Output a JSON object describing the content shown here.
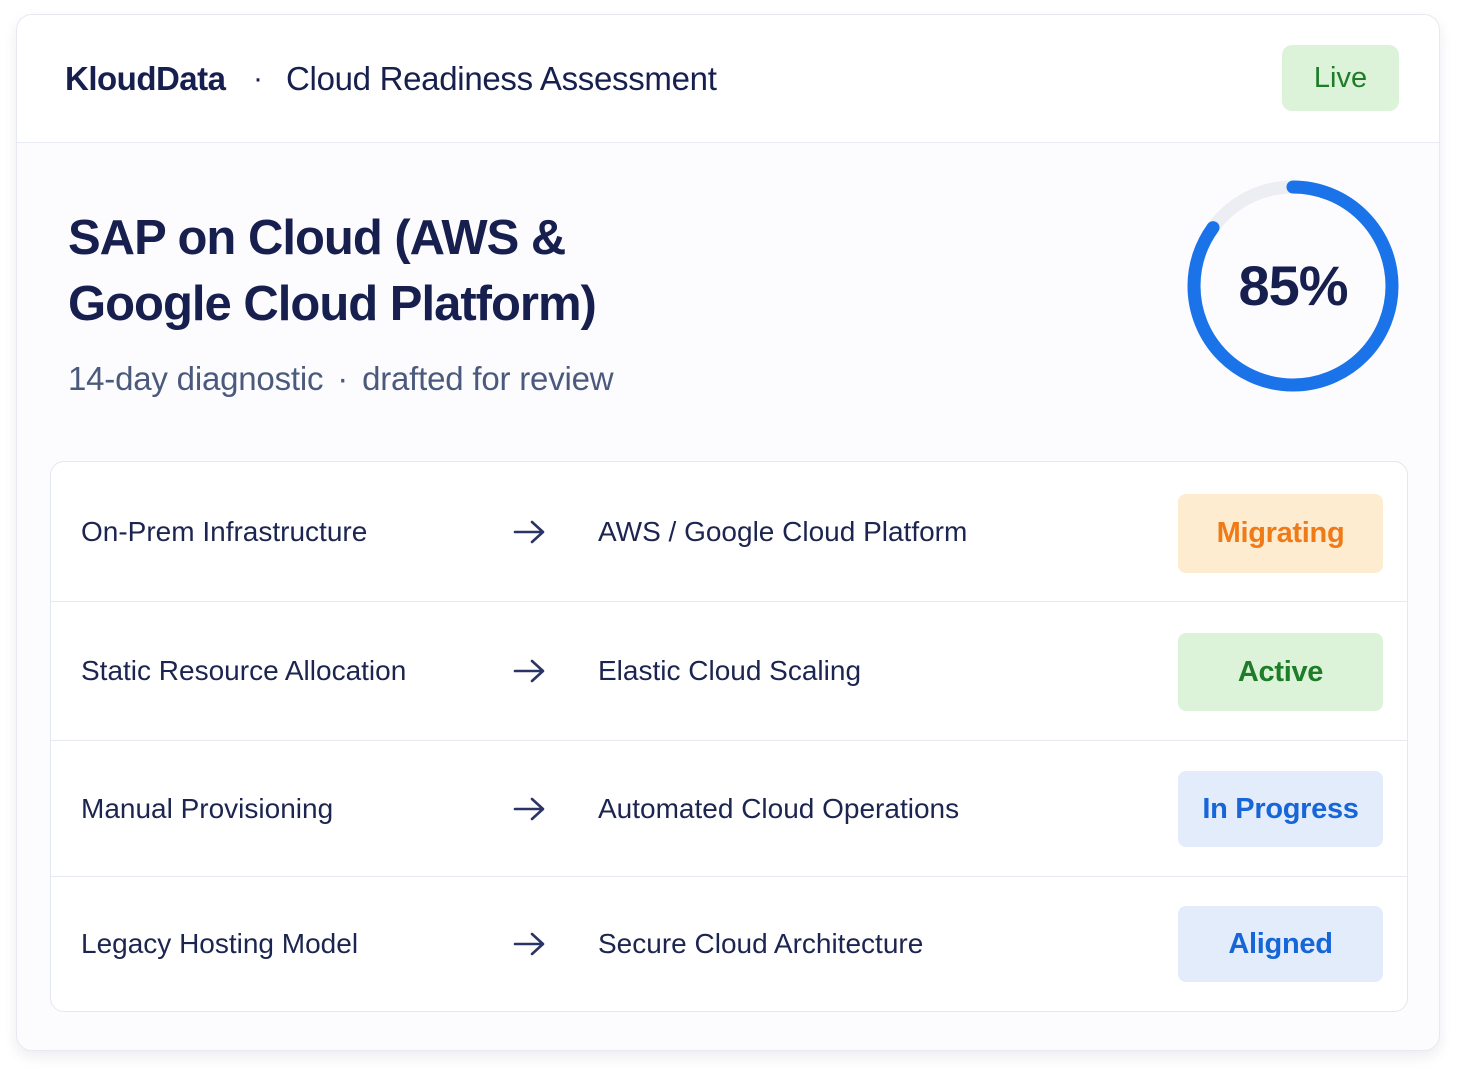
{
  "header": {
    "brand": "KloudData",
    "separator": "·",
    "title": "Cloud Readiness Assessment",
    "status_badge": "Live",
    "status_color": "#1f7d29"
  },
  "hero": {
    "title_line1": "SAP on Cloud (AWS &",
    "title_line2": "Google Cloud Platform)",
    "subtitle_part1": "14-day diagnostic",
    "subtitle_separator": "·",
    "subtitle_part2": "drafted for review"
  },
  "score": {
    "label": "85%",
    "value": 0.85,
    "track_color": "#eceef3",
    "fill_color": "#1a73e8"
  },
  "rows": [
    {
      "from": "On-Prem Infrastructure",
      "to": "AWS / Google Cloud Platform",
      "status": "Migrating",
      "status_color": "#f07a17",
      "status_bg": "#fdeccf"
    },
    {
      "from": "Static Resource Allocation",
      "to": "Elastic Cloud Scaling",
      "status": "Active",
      "status_color": "#1f7d29",
      "status_bg": "#dcf3da"
    },
    {
      "from": "Manual Provisioning",
      "to": "Automated Cloud Operations",
      "status": "In Progress",
      "status_color": "#1666d8",
      "status_bg": "#e3ecfa"
    },
    {
      "from": "Legacy Hosting Model",
      "to": "Secure Cloud Architecture",
      "status": "Aligned",
      "status_color": "#1666d8",
      "status_bg": "#e3ecfa"
    }
  ],
  "icons": {
    "arrow": "arrow-right-icon"
  }
}
